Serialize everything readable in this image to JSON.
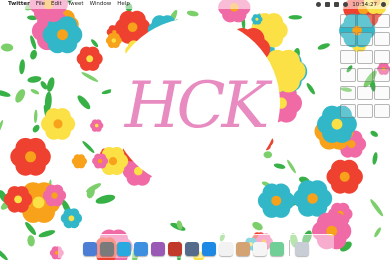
{
  "menubar": {
    "apple_symbol": "",
    "app_name": "Twitter",
    "items": [
      "File",
      "Edit",
      "Tweet",
      "Window",
      "Help"
    ],
    "clock": "10:34:27",
    "status_icons": [
      "wifi-icon",
      "volume-icon",
      "battery-icon",
      "bluetooth-icon",
      "search-icon"
    ]
  },
  "wallpaper": {
    "monogram": "HCK",
    "colors": {
      "monogram": "#e88bc0",
      "circle": "#ffffff",
      "pink": "#f06aa5",
      "red": "#ee4130",
      "orange": "#f8a11b",
      "yellow": "#fbe046",
      "green": "#37b045",
      "teal": "#32b7c8"
    }
  },
  "dock": {
    "apps": [
      "finder-icon",
      "system-preferences-icon",
      "twitter-icon",
      "safari-icon",
      "itunes-icon",
      "photo-booth-icon",
      "iphoto-icon",
      "app-store-icon",
      "calendar-icon",
      "preview-icon",
      "textedit-icon",
      "messages-icon"
    ],
    "colors": [
      "#4d7ed6",
      "#7a7a7a",
      "#2aa9e0",
      "#3f8fe0",
      "#9b59b6",
      "#c0392b",
      "#556b8b",
      "#1e88e5",
      "#f2f2f2",
      "#d4a373",
      "#f5f5f5",
      "#6fcf97"
    ],
    "trash": "trash-icon"
  }
}
